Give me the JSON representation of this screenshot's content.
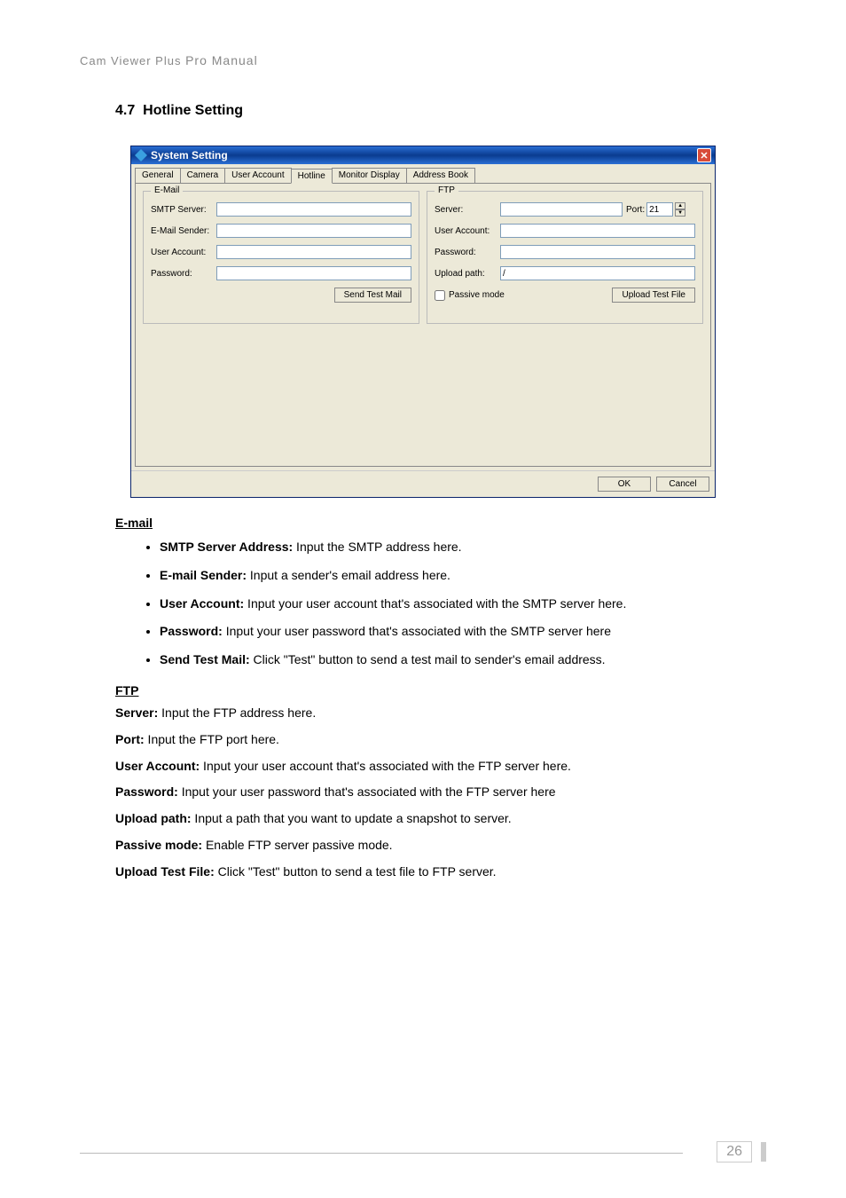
{
  "header": {
    "left": "Cam Viewer Plus",
    "right": "Pro Manual"
  },
  "section": {
    "number": "4.7",
    "title": "Hotline Setting"
  },
  "dialog": {
    "title": "System Setting",
    "tabs": [
      "General",
      "Camera",
      "User Account",
      "Hotline",
      "Monitor Display",
      "Address Book"
    ],
    "activeTabIndex": 3,
    "email": {
      "legend": "E-Mail",
      "smtp_label": "SMTP Server:",
      "smtp_value": "",
      "sender_label": "E-Mail Sender:",
      "sender_value": "",
      "user_label": "User Account:",
      "user_value": "",
      "pass_label": "Password:",
      "pass_value": "",
      "test_btn": "Send Test Mail"
    },
    "ftp": {
      "legend": "FTP",
      "server_label": "Server:",
      "server_value": "",
      "port_label": "Port:",
      "port_value": "21",
      "user_label": "User Account:",
      "user_value": "",
      "pass_label": "Password:",
      "pass_value": "",
      "path_label": "Upload path:",
      "path_value": "/",
      "passive_label": "Passive mode",
      "test_btn": "Upload Test File"
    },
    "ok": "OK",
    "cancel": "Cancel"
  },
  "body": {
    "email_head": "E-mail",
    "email_items": [
      {
        "b": "SMTP Server Address:",
        "t": " Input the SMTP address here."
      },
      {
        "b": "E-mail Sender:",
        "t": " Input a sender's email address here."
      },
      {
        "b": "User Account:",
        "t": " Input your user account that's associated with the SMTP server here."
      },
      {
        "b": "Password:",
        "t": " Input your user password that's associated with the SMTP server here"
      },
      {
        "b": "Send Test Mail:",
        "t": " Click \"Test\" button to send a test mail to sender's email address."
      }
    ],
    "ftp_head": "FTP",
    "ftp_items": [
      {
        "b": "Server:",
        "t": " Input the FTP address here."
      },
      {
        "b": "Port:",
        "t": " Input the FTP port here."
      },
      {
        "b": "User Account:",
        "t": " Input your user account that's associated with the FTP server here."
      },
      {
        "b": "Password:",
        "t": " Input your user password that's associated with the FTP server here"
      },
      {
        "b": "Upload path:",
        "t": " Input a path that you want to update a snapshot to server."
      },
      {
        "b": "Passive mode:",
        "t": " Enable FTP server passive mode."
      },
      {
        "b": "Upload Test File:",
        "t": " Click \"Test\" button to send a test file to FTP server."
      }
    ]
  },
  "page_number": "26"
}
